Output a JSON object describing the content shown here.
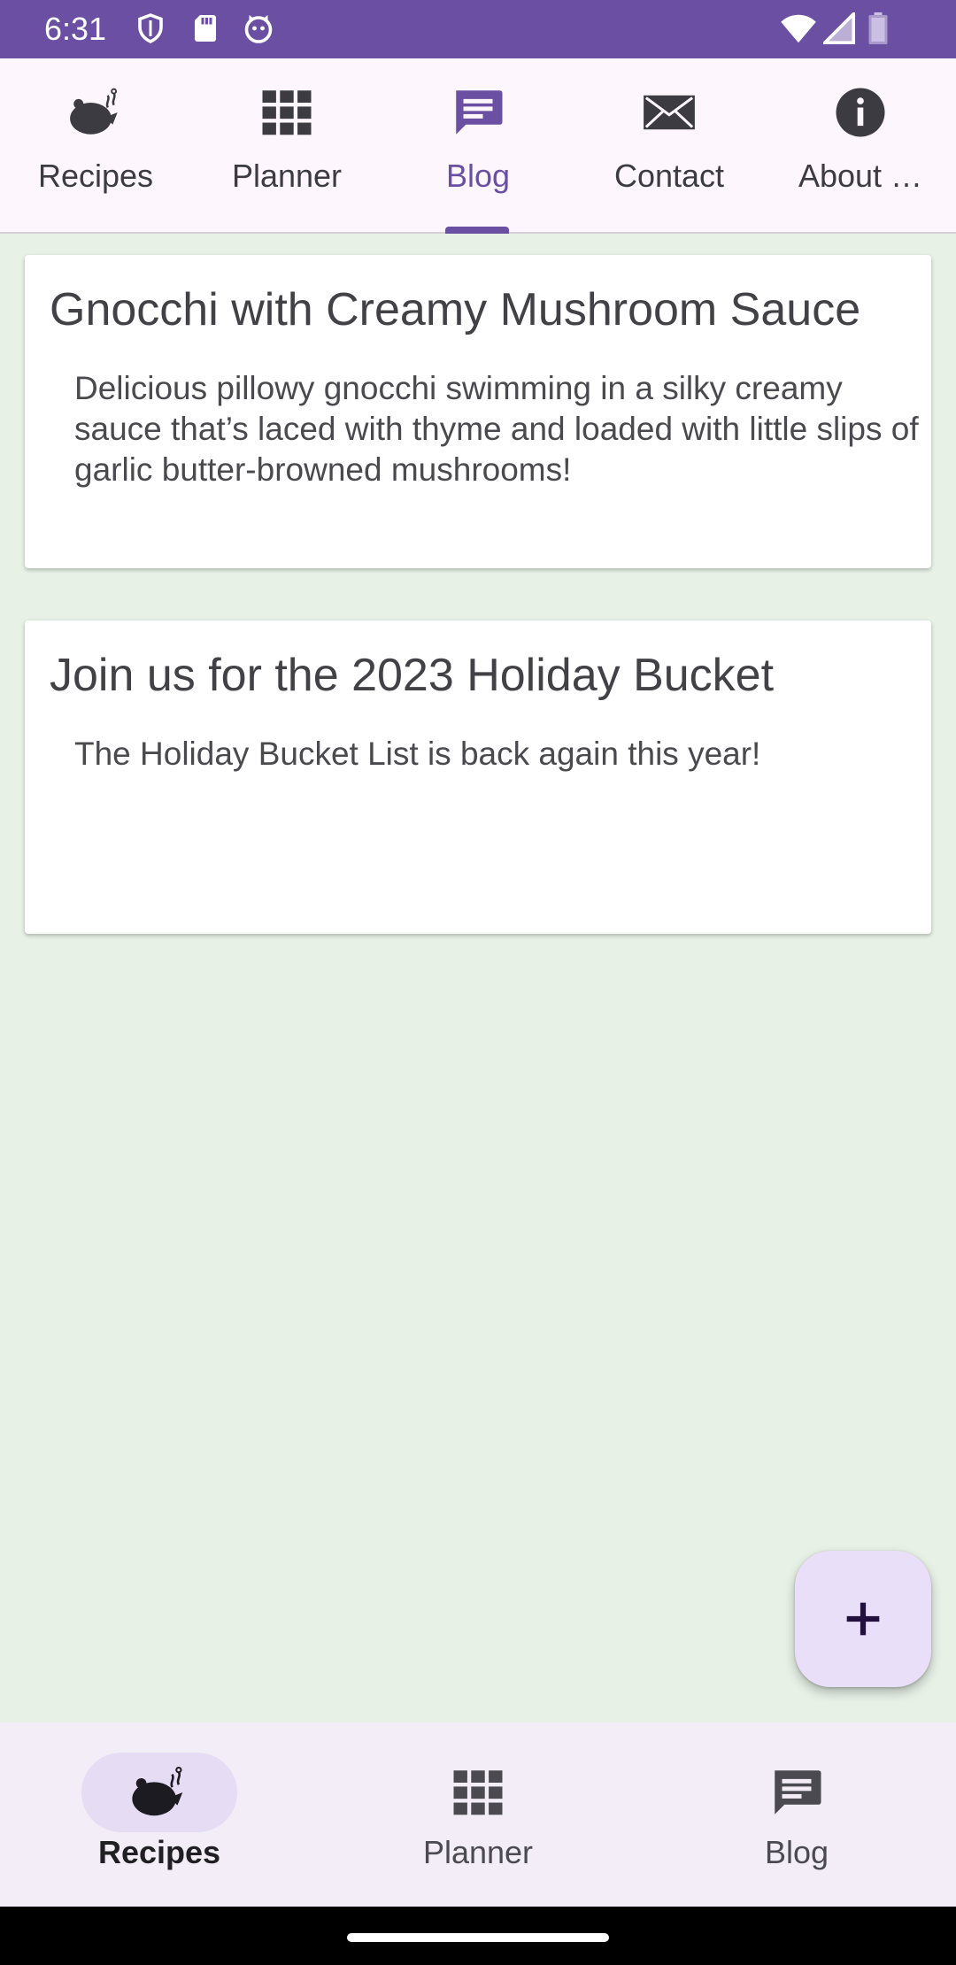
{
  "status_bar": {
    "time": "6:31",
    "left_icons": [
      "shield-icon",
      "sd-card-icon",
      "cat-face-icon"
    ],
    "right_icons": [
      "wifi-icon",
      "cell-signal-icon",
      "battery-icon"
    ],
    "color": "#6a4fa3"
  },
  "top_tabs": [
    {
      "label": "Recipes",
      "icon": "teapot-icon",
      "active": false
    },
    {
      "label": "Planner",
      "icon": "grid-icon",
      "active": false
    },
    {
      "label": "Blog",
      "icon": "comment-icon",
      "active": true
    },
    {
      "label": "Contact",
      "icon": "envelope-icon",
      "active": false
    },
    {
      "label": "About …",
      "icon": "info-icon",
      "active": false
    }
  ],
  "posts": [
    {
      "title": "Gnocchi with Creamy Mushroom Sauce",
      "summary": "Delicious pillowy gnocchi swimming in a silky creamy sauce that’s laced with thyme and loaded with little slips of garlic butter-browned mushrooms!"
    },
    {
      "title": "Join us for the 2023 Holiday Bucket",
      "summary": "The Holiday Bucket List is back again this year!"
    }
  ],
  "fab": {
    "icon": "plus-icon"
  },
  "bottom_nav": [
    {
      "label": "Recipes",
      "icon": "teapot-icon",
      "active": true
    },
    {
      "label": "Planner",
      "icon": "grid-icon",
      "active": false
    },
    {
      "label": "Blog",
      "icon": "comment-icon",
      "active": false
    }
  ],
  "colors": {
    "accent": "#6a4fa3",
    "background": "#e7f1e6",
    "fab_bg": "#eadff9",
    "nav_bg": "#f2edf6"
  }
}
